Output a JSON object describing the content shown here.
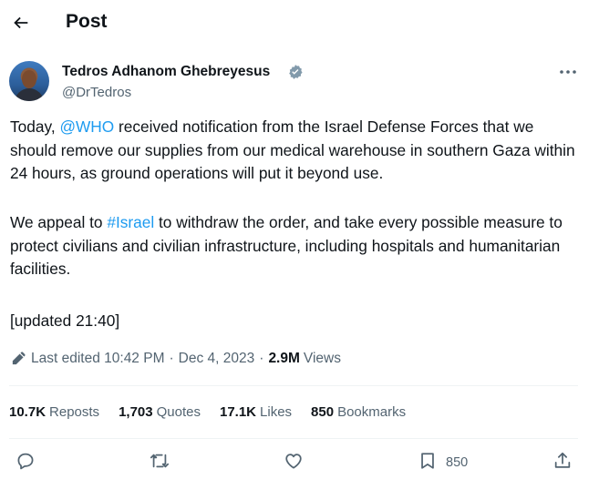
{
  "header": {
    "title": "Post"
  },
  "author": {
    "name": "Tedros Adhanom Ghebreyesus",
    "handle": "@DrTedros"
  },
  "body": {
    "p1_before": "Today, ",
    "p1_mention": "@WHO",
    "p1_after": " received notification from the Israel Defense Forces that we should remove our supplies from our medical warehouse in southern Gaza within 24 hours, as ground operations will put it beyond use.",
    "p2_before": "We appeal to ",
    "p2_hashtag": "#Israel",
    "p2_after": " to withdraw the order, and take every possible measure to protect civilians and civilian infrastructure, including hospitals and humanitarian facilities.",
    "p3": "[updated 21:40]"
  },
  "meta": {
    "edited_label": "Last edited 10:42 PM",
    "separator": "·",
    "date": "Dec 4, 2023",
    "views_count": "2.9M",
    "views_label": "Views"
  },
  "stats": [
    {
      "num": "10.7K",
      "label": "Reposts"
    },
    {
      "num": "1,703",
      "label": "Quotes"
    },
    {
      "num": "17.1K",
      "label": "Likes"
    },
    {
      "num": "850",
      "label": "Bookmarks"
    }
  ],
  "actions": {
    "bookmark_count": "850"
  },
  "colors": {
    "accent": "#1d9bf0",
    "muted": "#536471",
    "text": "#0f1419",
    "divider": "#eff3f4"
  },
  "icons": [
    "back-arrow-icon",
    "verified-badge-icon",
    "more-options-icon",
    "pencil-icon",
    "reply-icon",
    "repost-icon",
    "like-icon",
    "bookmark-icon",
    "share-icon"
  ]
}
